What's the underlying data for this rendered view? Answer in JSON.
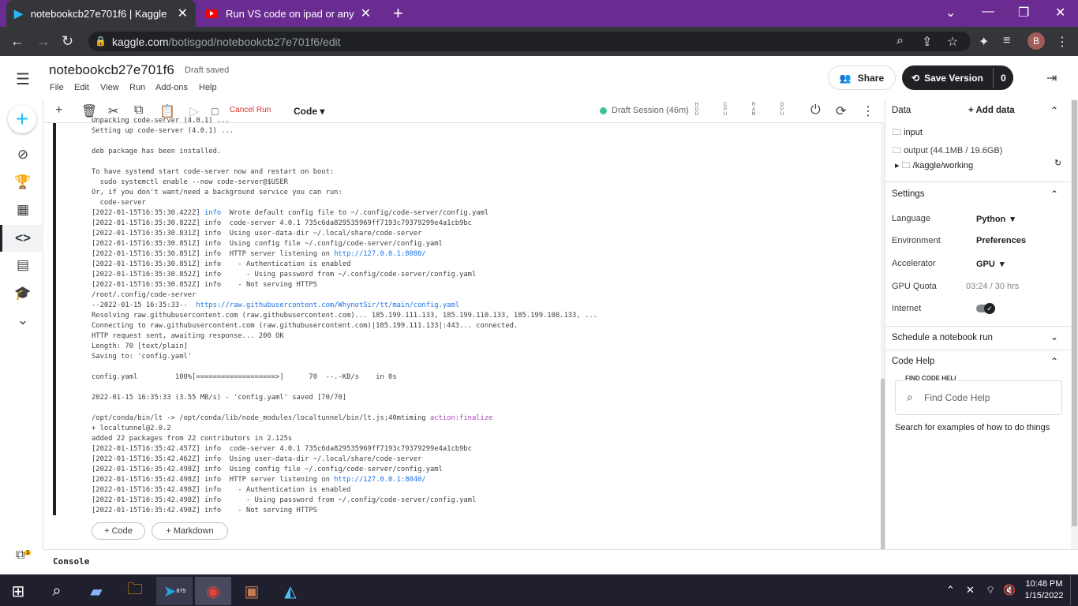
{
  "browser": {
    "tabs": [
      {
        "title": "notebookcb27e701f6 | Kaggle"
      },
      {
        "title": "Run VS code on ipad or any devi"
      }
    ],
    "url_host": "kaggle.com",
    "url_path": "/botisgod/notebookcb27e701f6/edit",
    "profile_initial": "B"
  },
  "header": {
    "notebook_title": "notebookcb27e701f6",
    "status": "Draft saved",
    "menus": [
      "File",
      "Edit",
      "View",
      "Run",
      "Add-ons",
      "Help"
    ],
    "share": "Share",
    "save_version": "Save Version",
    "save_count": "0"
  },
  "toolbar": {
    "cancel_run": "Cancel Run",
    "cell_type": "Code",
    "session": "Draft Session (46m)",
    "meters": [
      "HDD",
      "CPU",
      "RAM",
      "GPU"
    ]
  },
  "output_lines": [
    {
      "t": "Unpacking code-server (4.0.1) ..."
    },
    {
      "t": "Setting up code-server (4.0.1) ..."
    },
    {
      "t": ""
    },
    {
      "t": "deb package has been installed."
    },
    {
      "t": ""
    },
    {
      "t": "To have systemd start code-server now and restart on boot:"
    },
    {
      "t": "  sudo systemctl enable --now code-server@$USER"
    },
    {
      "t": "Or, if you don't want/need a background service you can run:"
    },
    {
      "t": "  code-server"
    },
    {
      "pre": "[2022-01-15T16:35:30.422Z] ",
      "blue": "info",
      "t": "  Wrote default config file to ~/.config/code-server/config.yaml"
    },
    {
      "t": "[2022-01-15T16:35:30.822Z] info  code-server 4.0.1 735c6da829535969ff7193c79379299e4a1cb9bc"
    },
    {
      "t": "[2022-01-15T16:35:30.831Z] info  Using user-data-dir ~/.local/share/code-server"
    },
    {
      "t": "[2022-01-15T16:35:30.851Z] info  Using config file ~/.config/code-server/config.yaml"
    },
    {
      "pre": "[2022-01-15T16:35:30.851Z] info  HTTP server listening on ",
      "blue": "http://127.0.0.1:8080/",
      "t": ""
    },
    {
      "t": "[2022-01-15T16:35:30.851Z] info    - Authentication is enabled"
    },
    {
      "t": "[2022-01-15T16:35:30.852Z] info      - Using password from ~/.config/code-server/config.yaml"
    },
    {
      "t": "[2022-01-15T16:35:30.852Z] info    - Not serving HTTPS"
    },
    {
      "t": "/root/.config/code-server"
    },
    {
      "pre": "--2022-01-15 16:35:33--  ",
      "blue": "https://raw.githubusercontent.com/WhynotSir/tt/main/config.yaml",
      "t": ""
    },
    {
      "t": "Resolving raw.githubusercontent.com (raw.githubusercontent.com)... 185.199.111.133, 185.199.110.133, 185.199.108.133, ..."
    },
    {
      "t": "Connecting to raw.githubusercontent.com (raw.githubusercontent.com)|185.199.111.133|:443... connected."
    },
    {
      "t": "HTTP request sent, awaiting response... 200 OK"
    },
    {
      "t": "Length: 70 [text/plain]"
    },
    {
      "t": "Saving to: 'config.yaml'"
    },
    {
      "t": ""
    },
    {
      "t": "config.yaml         100%[===================>]      70  --.-KB/s    in 0s"
    },
    {
      "t": ""
    },
    {
      "t": "2022-01-15 16:35:33 (3.55 MB/s) - 'config.yaml' saved [70/70]"
    },
    {
      "t": ""
    },
    {
      "pre": "/opt/conda/bin/lt -> /opt/conda/lib/node_modules/localtunnel/bin/lt.js;40mtiming ",
      "pink": "action:finalize",
      "t": ""
    },
    {
      "t": "+ localtunnel@2.0.2"
    },
    {
      "t": "added 22 packages from 22 contributors in 2.125s"
    },
    {
      "t": "[2022-01-15T16:35:42.457Z] info  code-server 4.0.1 735c6da829535969ff7193c79379299e4a1cb9bc"
    },
    {
      "t": "[2022-01-15T16:35:42.462Z] info  Using user-data-dir ~/.local/share/code-server"
    },
    {
      "t": "[2022-01-15T16:35:42.498Z] info  Using config file ~/.config/code-server/config.yaml"
    },
    {
      "pre": "[2022-01-15T16:35:42.498Z] info  HTTP server listening on ",
      "blue": "http://127.0.0.1:8040/",
      "t": ""
    },
    {
      "t": "[2022-01-15T16:35:42.498Z] info    - Authentication is enabled"
    },
    {
      "t": "[2022-01-15T16:35:42.498Z] info      - Using password from ~/.config/code-server/config.yaml"
    },
    {
      "t": "[2022-01-15T16:35:42.498Z] info    - Not serving HTTPS"
    }
  ],
  "cell_buttons": {
    "code": "+ Code",
    "markdown": "+ Markdown"
  },
  "panel": {
    "data_title": "Data",
    "add_data": "Add data",
    "input": "input",
    "output": "output (44.1MB / 19.6GB)",
    "working": "/kaggle/working",
    "settings_title": "Settings",
    "language_label": "Language",
    "language_value": "Python",
    "environment_label": "Environment",
    "environment_value": "Preferences",
    "accelerator_label": "Accelerator",
    "accelerator_value": "GPU",
    "gpu_quota_label": "GPU Quota",
    "gpu_quota_value": "03:24 / 30 hrs",
    "internet_label": "Internet",
    "internet_on": true,
    "schedule": "Schedule a notebook run",
    "code_help": "Code Help",
    "find_label": "FIND CODE HELI",
    "find_placeholder": "Find Code Help",
    "search_hint": "Search for examples of how to do things"
  },
  "console": "Console",
  "taskbar": {
    "time": "10:48 PM",
    "date": "1/15/2022",
    "telegram_badge": "875",
    "notif_badge": "1"
  },
  "colors": {
    "kaggle_blue": "#20beff",
    "tab_purple": "#6a2c91",
    "session_green": "#3ec28f",
    "cancel_red": "#d93025"
  }
}
